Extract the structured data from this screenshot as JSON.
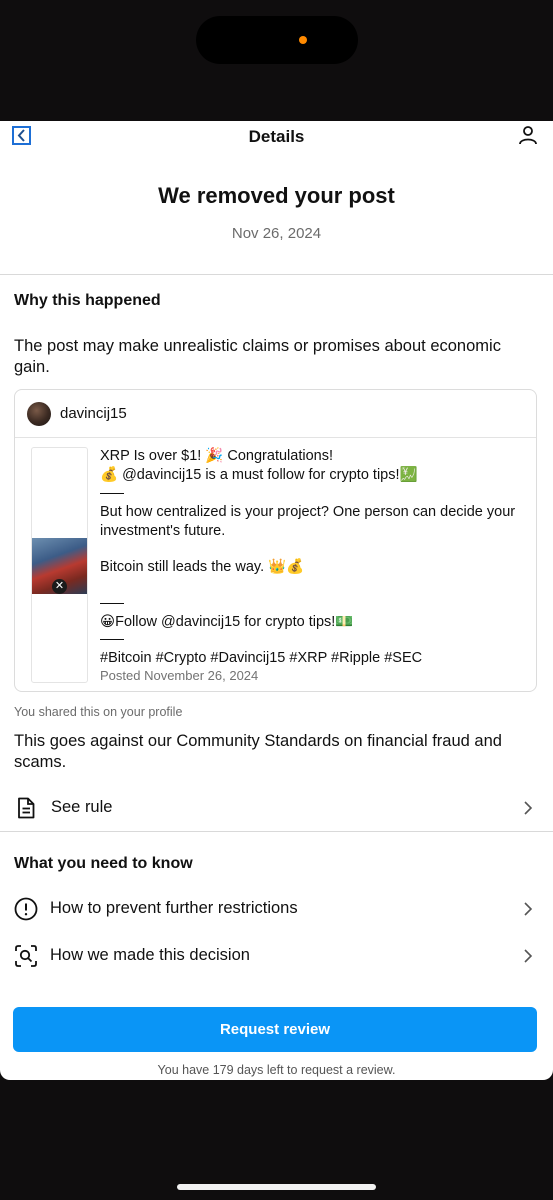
{
  "nav": {
    "title": "Details"
  },
  "notice": {
    "headline": "We removed your post",
    "date": "Nov 26, 2024"
  },
  "why": {
    "title": "Why this happened",
    "reason": "The post may make unrealistic claims or promises about economic gain."
  },
  "post": {
    "username": "davincij15",
    "line1": "XRP Is over $1! 🎉 Congratulations!",
    "line2": "💰 @davincij15 is a must follow for crypto tips!💹",
    "sep": "——",
    "line3": "But how centralized is your project? One person can decide your investment's future.",
    "line4": "Bitcoin still leads the way. 👑💰",
    "line5": "😀Follow @davincij15 for crypto tips!💵",
    "hashtags": "#Bitcoin #Crypto #Davincij15 #XRP #Ripple #SEC",
    "posted": "Posted November 26, 2024"
  },
  "shared_note": "You shared this on your profile",
  "standards_text": "This goes against our Community Standards on financial fraud and scams.",
  "see_rule": {
    "label": "See rule",
    "icon": "document-icon"
  },
  "know": {
    "title": "What you need to know",
    "items": [
      {
        "label": "How to prevent further restrictions",
        "icon": "alert-circle-icon"
      },
      {
        "label": "How we made this decision",
        "icon": "scan-search-icon"
      }
    ]
  },
  "cta": {
    "label": "Request review",
    "color": "#0a95f6"
  },
  "footnote": "You have 179 days left to request a review."
}
